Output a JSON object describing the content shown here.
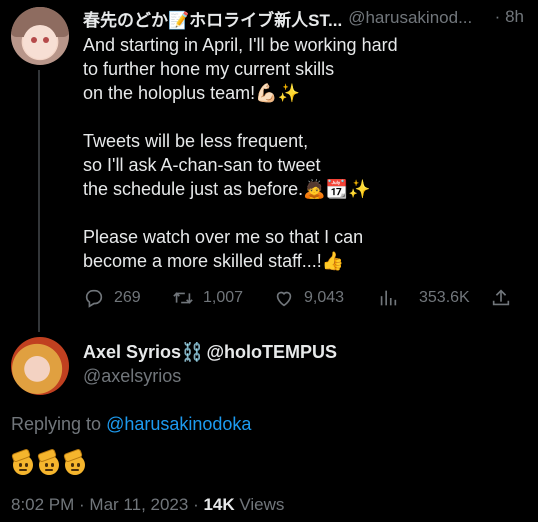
{
  "tweet1": {
    "display_name": "春先のどか📝ホロライブ新人ST...",
    "handle": "@harusakinod...",
    "time_sep": "·",
    "time": "8h",
    "lines": [
      "And starting in April, I'll be working hard",
      "to further hone my current skills",
      "on the holoplus team!💪🏻✨",
      "",
      "Tweets will be less frequent,",
      "so I'll ask A-chan-san to tweet",
      "the schedule just as before.🙇📆✨",
      "",
      "Please watch over me so that I can",
      "become a more skilled staff...!👍"
    ],
    "actions": {
      "replies": "269",
      "retweets": "1,007",
      "likes": "9,043",
      "views": "353.6K"
    },
    "icons": [
      "reply-icon",
      "retweet-icon",
      "like-icon",
      "views-icon",
      "share-icon"
    ]
  },
  "tweet2": {
    "display_name": "Axel Syrios⛓️",
    "handle_inline": "@holoTEMPUS",
    "handle": "@axelsyrios",
    "replying_prefix": "Replying to ",
    "replying_to": "@harusakinodoka",
    "emoji_text": "🫡🫡🫡",
    "time": "8:02 PM",
    "sep1": " · ",
    "date": "Mar 11, 2023",
    "sep2": " · ",
    "views_count": "14K",
    "views_label": " Views"
  },
  "colors": {
    "background": "#000000",
    "text": "#e7e9ea",
    "muted": "#71767b",
    "link": "#1d9bf0"
  }
}
